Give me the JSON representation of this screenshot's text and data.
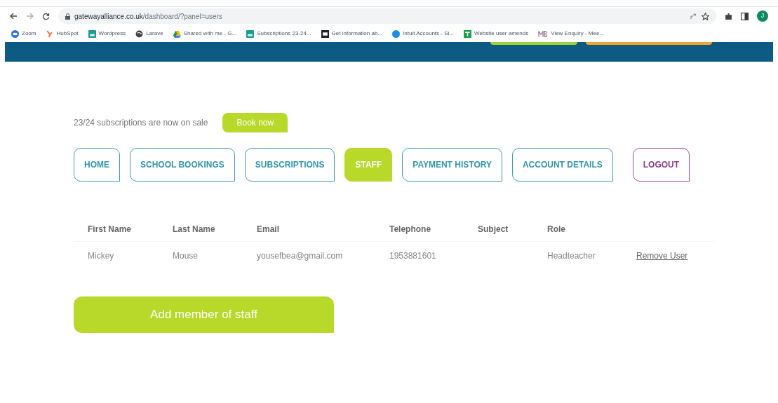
{
  "browser": {
    "url_host": "gatewayalliance.co.uk",
    "url_path": "/dashboard/?panel=users",
    "profile_initial": "J",
    "bookmarks": [
      {
        "kind": "zoom",
        "label": "Zoom"
      },
      {
        "kind": "hubspot",
        "label": "HubSpot"
      },
      {
        "kind": "sheet",
        "label": "Wordpress"
      },
      {
        "kind": "globe",
        "label": "Larave"
      },
      {
        "kind": "drive",
        "label": "Shared with me - G..."
      },
      {
        "kind": "sheet",
        "label": "Subscriptions 23-24..."
      },
      {
        "kind": "box",
        "label": "Get information ab..."
      },
      {
        "kind": "intuit",
        "label": "Intuit Accounts - Si..."
      },
      {
        "kind": "green",
        "label": "Website user amends"
      },
      {
        "kind": "mb",
        "label": "View Enquiry - Mee..."
      }
    ]
  },
  "promo": {
    "text": "23/24 subscriptions are now on sale",
    "button": "Book now"
  },
  "nav": [
    {
      "label": "HOME",
      "kind": "nav",
      "selected": false
    },
    {
      "label": "SCHOOL BOOKINGS",
      "kind": "nav",
      "selected": false
    },
    {
      "label": "SUBSCRIPTIONS",
      "kind": "nav",
      "selected": false
    },
    {
      "label": "STAFF",
      "kind": "nav",
      "selected": true
    },
    {
      "label": "PAYMENT HISTORY",
      "kind": "nav",
      "selected": false
    },
    {
      "label": "ACCOUNT DETAILS",
      "kind": "nav",
      "selected": false
    },
    {
      "label": "LOGOUT",
      "kind": "logout",
      "selected": false
    }
  ],
  "table": {
    "columns": [
      "First Name",
      "Last Name",
      "Email",
      "Telephone",
      "Subject",
      "Role"
    ],
    "rows": [
      {
        "cells": [
          "Mickey",
          "Mouse",
          "yousefbea@gmail.com",
          "1953881601",
          "",
          "Headteacher"
        ],
        "action": "Remove User"
      }
    ]
  },
  "add_button": "Add member of staff"
}
